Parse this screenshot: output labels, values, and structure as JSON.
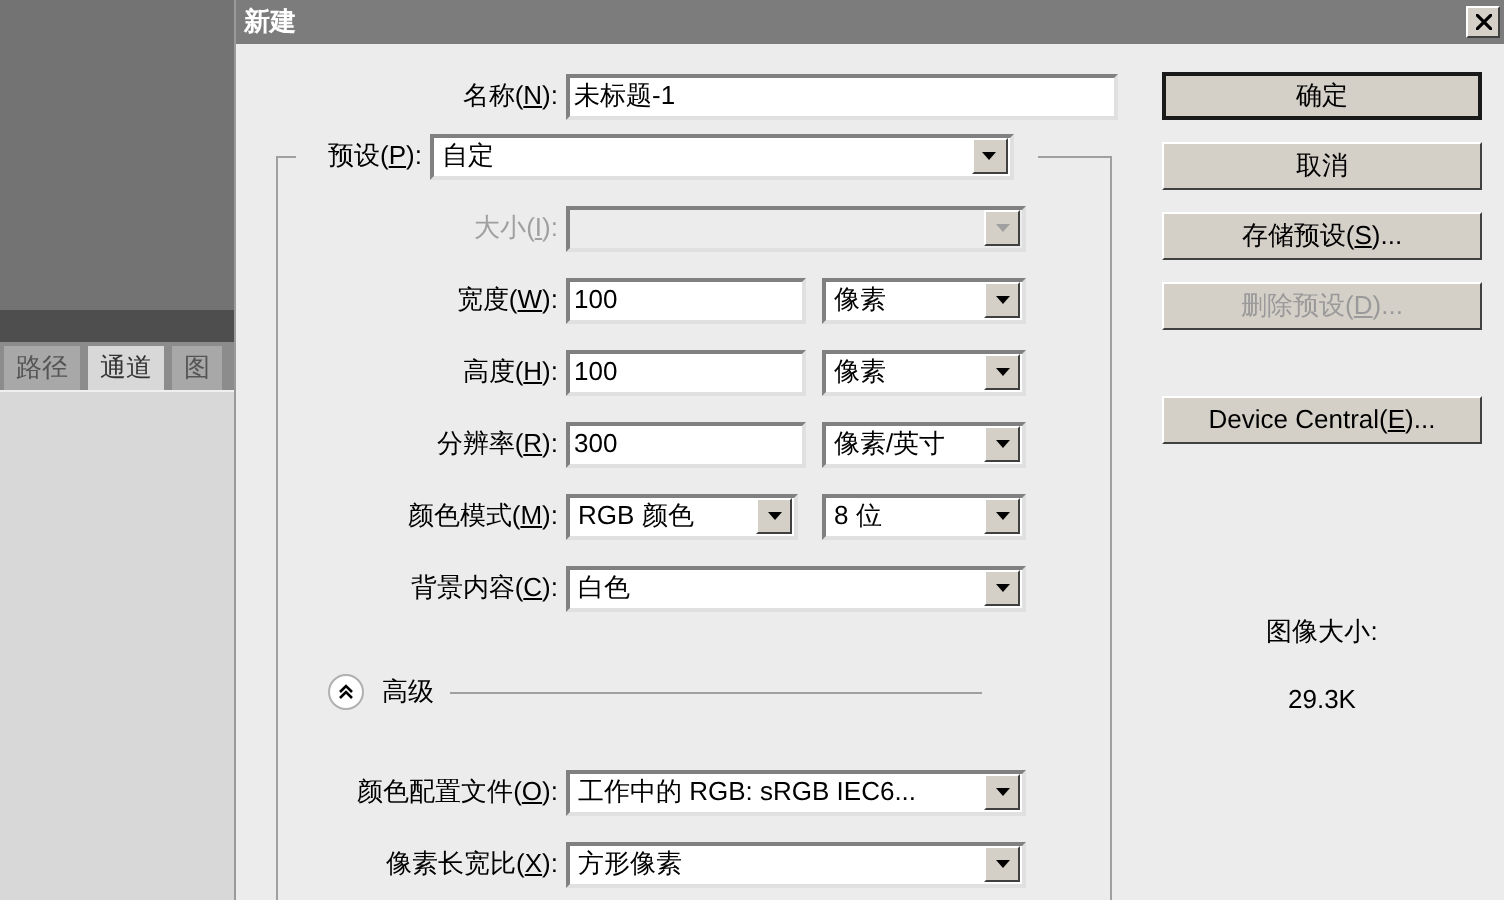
{
  "background": {
    "tabs": [
      {
        "label": "路径",
        "selected": false
      },
      {
        "label": "通道",
        "selected": true
      },
      {
        "label": "图",
        "selected": false
      }
    ]
  },
  "dialog": {
    "title": "新建",
    "name": {
      "kind": "text",
      "label": {
        "before": "名称(",
        "key": "N",
        "after": "):"
      },
      "value": "未标题-1"
    },
    "preset": {
      "label": {
        "before": "预设(",
        "key": "P",
        "after": "):"
      },
      "value": "自定"
    },
    "fields": [
      {
        "kind": "select",
        "disabled": true,
        "label": {
          "before": "大小(",
          "key": "I",
          "after": "):"
        }
      },
      {
        "kind": "text_unit",
        "disabled": false,
        "label": {
          "before": "宽度(",
          "key": "W",
          "after": "):"
        },
        "value": "100",
        "unit": "像素"
      },
      {
        "kind": "text_unit",
        "disabled": false,
        "label": {
          "before": "高度(",
          "key": "H",
          "after": "):"
        },
        "value": "100",
        "unit": "像素"
      },
      {
        "kind": "text_unit",
        "disabled": false,
        "label": {
          "before": "分辨率(",
          "key": "R",
          "after": "):"
        },
        "value": "300",
        "unit": "像素/英寸"
      },
      {
        "kind": "select_pair",
        "disabled": false,
        "label": {
          "before": "颜色模式(",
          "key": "M",
          "after": "):"
        },
        "value": "RGB 颜色",
        "value2": "8 位"
      },
      {
        "kind": "select",
        "disabled": false,
        "label": {
          "before": "背景内容(",
          "key": "C",
          "after": "):"
        },
        "value": "白色"
      }
    ],
    "advanced": {
      "label": "高级",
      "expanded": true,
      "fields": [
        {
          "kind": "select",
          "disabled": false,
          "label": {
            "before": "颜色配置文件(",
            "key": "O",
            "after": "):"
          },
          "value": "工作中的 RGB: sRGB IEC6..."
        },
        {
          "kind": "select",
          "disabled": false,
          "label": {
            "before": "像素长宽比(",
            "key": "X",
            "after": "):"
          },
          "value": "方形像素"
        }
      ]
    },
    "buttons": [
      {
        "label": {
          "before": "确定"
        },
        "default": true,
        "disabled": false
      },
      {
        "label": {
          "before": "取消"
        },
        "default": false,
        "disabled": false
      },
      {
        "label": {
          "before": "存储预设(",
          "key": "S",
          "after": ")..."
        },
        "default": false,
        "disabled": false
      },
      {
        "label": {
          "before": "删除预设(",
          "key": "D",
          "after": ")..."
        },
        "default": false,
        "disabled": true
      },
      {
        "label": {
          "before": "Device Central(",
          "key": "E",
          "after": ")..."
        },
        "default": false,
        "disabled": false
      }
    ],
    "image_size": {
      "label": "图像大小:",
      "value": "29.3K"
    }
  }
}
